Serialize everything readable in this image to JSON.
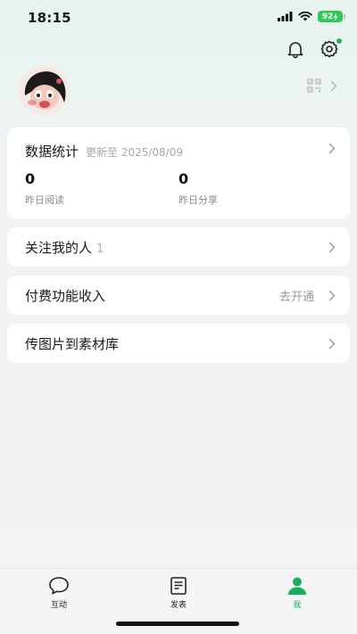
{
  "status_bar": {
    "time": "18:15",
    "battery": "92"
  },
  "stats": {
    "title": "数据统计",
    "updated": "更新至 2025/08/09",
    "items": [
      {
        "value": "0",
        "label": "昨日阅读"
      },
      {
        "value": "0",
        "label": "昨日分享"
      }
    ]
  },
  "rows": {
    "followers": {
      "label": "关注我的人",
      "count": "1"
    },
    "paid": {
      "label": "付费功能收入",
      "action": "去开通"
    },
    "upload": {
      "label": "传图片到素材库"
    }
  },
  "tabbar": {
    "tabs": [
      {
        "label": "互动",
        "icon": "chat-bubble-icon"
      },
      {
        "label": "发表",
        "icon": "document-icon"
      },
      {
        "label": "我",
        "icon": "person-icon",
        "active": true
      }
    ],
    "active_color": "#1aad5a"
  },
  "colors": {
    "accent": "#1aad5a",
    "notification_dot": "#22b35c",
    "battery": "#34c759"
  }
}
